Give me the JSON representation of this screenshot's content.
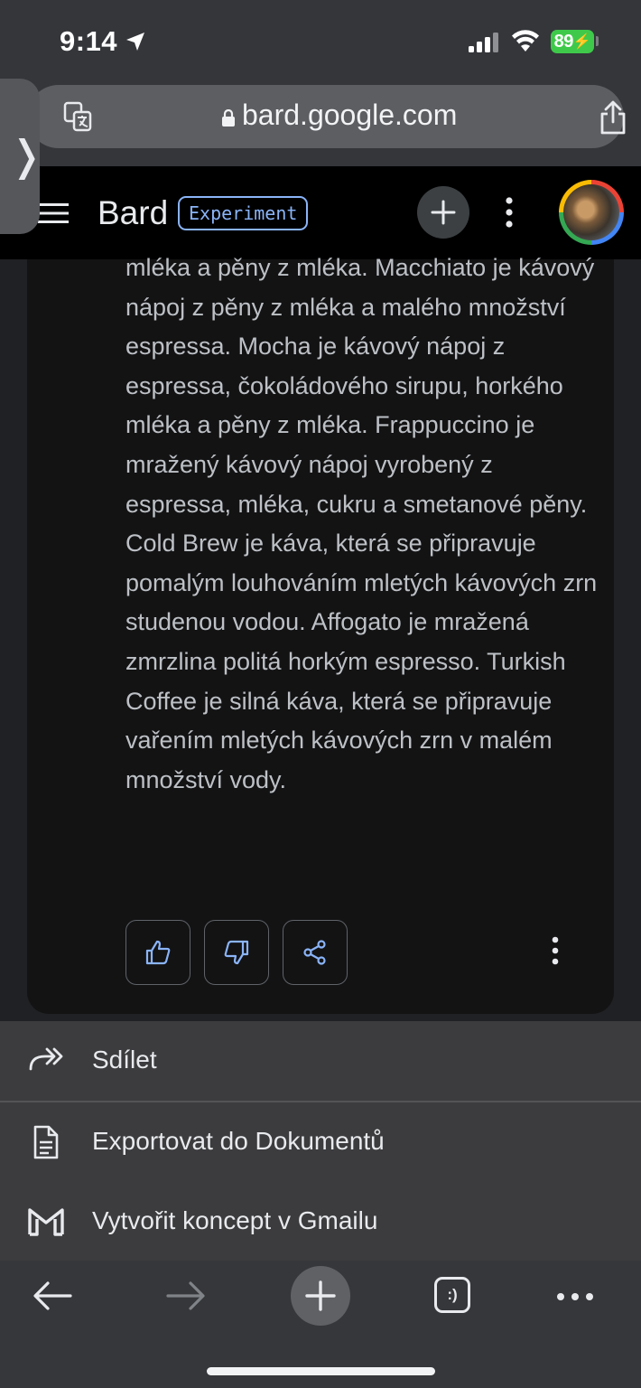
{
  "status": {
    "time": "9:14",
    "battery": "89"
  },
  "browser": {
    "url": "bard.google.com"
  },
  "app": {
    "title": "Bard",
    "badge": "Experiment"
  },
  "response": {
    "text": "mléka a pěny z mléka. Macchiato je kávový nápoj z pěny z mléka a malého množství espressa. Mocha je kávový nápoj z espressa, čokoládového sirupu, horkého mléka a pěny z mléka. Frappuccino je mražený kávový nápoj vyrobený z espressa, mléka, cukru a smetanové pěny. Cold Brew je káva, která se připravuje pomalým louhováním mletých kávových zrn studenou vodou. Affogato je mražená zmrzlina politá horkým espresso. Turkish Coffee je silná káva, která se připravuje vařením mletých kávových zrn v malém množství vody."
  },
  "share_menu": {
    "items": [
      {
        "label": "Sdílet",
        "icon": "share-forward-icon"
      },
      {
        "label": "Exportovat do Dokumentů",
        "icon": "docs-icon"
      },
      {
        "label": "Vytvořit koncept v Gmailu",
        "icon": "gmail-icon"
      }
    ]
  },
  "toolbar": {
    "tabs_label": ":)"
  },
  "colors": {
    "accent": "#8ab4f8",
    "battery": "#3fc94a",
    "background": "#202124"
  }
}
